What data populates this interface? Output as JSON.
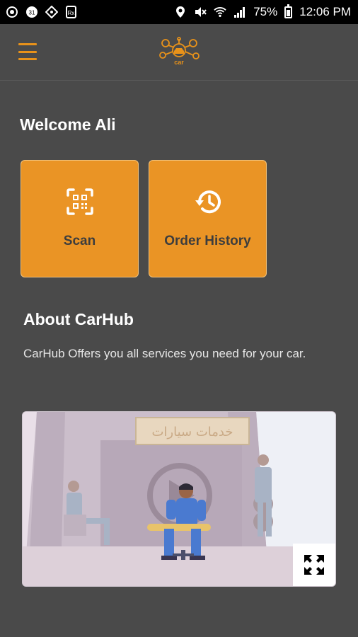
{
  "status_bar": {
    "battery": "75%",
    "time": "12:06 PM"
  },
  "app_bar": {
    "menu_icon": "hamburger-icon",
    "logo_icon": "carhub-logo"
  },
  "welcome": "Welcome Ali",
  "actions": [
    {
      "label": "Scan",
      "icon": "qr-scan-icon"
    },
    {
      "label": "Order History",
      "icon": "history-icon"
    }
  ],
  "about": {
    "title": "About CarHub",
    "description": "CarHub Offers you all services you need for your car."
  },
  "video": {
    "sign_text": "خدمات سيارات",
    "expand_icon": "fullscreen-icon"
  },
  "colors": {
    "accent": "#ea9425",
    "background": "#4a4a4a",
    "status_bar": "#000000"
  }
}
